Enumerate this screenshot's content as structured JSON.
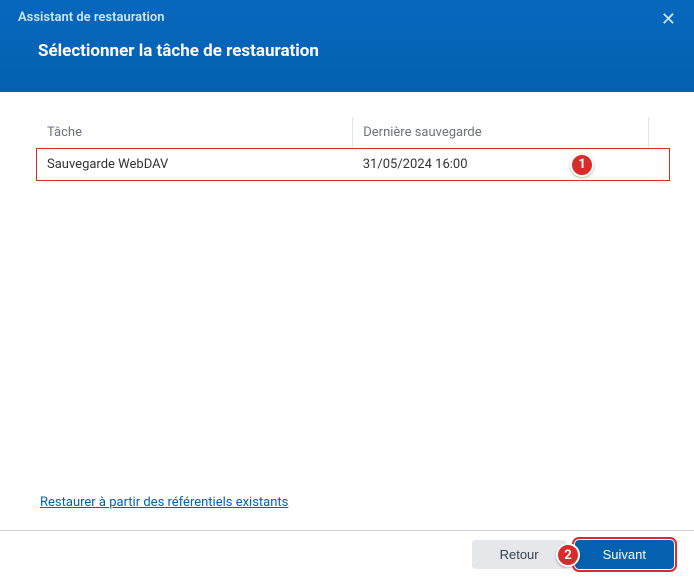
{
  "header": {
    "assistant_label": "Assistant de restauration",
    "title": "Sélectionner la tâche de restauration"
  },
  "table": {
    "col_task": "Tâche",
    "col_date": "Dernière sauvegarde",
    "rows": [
      {
        "task": "Sauvegarde WebDAV",
        "date": "31/05/2024 16:00"
      }
    ]
  },
  "annotations": {
    "badge1": "1",
    "badge2": "2"
  },
  "link": {
    "restore_existing": "Restaurer à partir des référentiels existants"
  },
  "footer": {
    "back": "Retour",
    "next": "Suivant"
  }
}
